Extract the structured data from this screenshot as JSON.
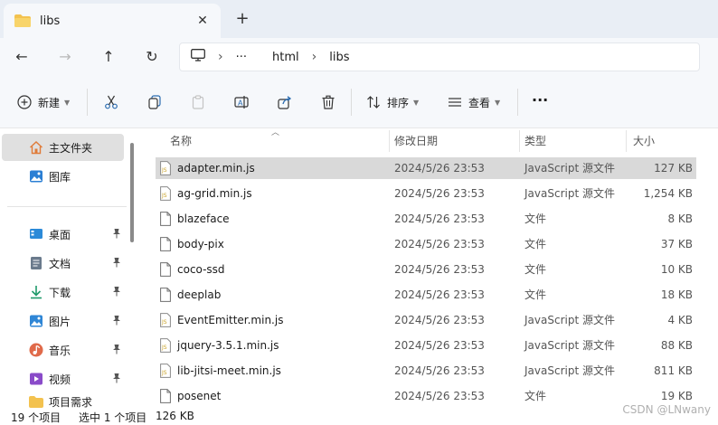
{
  "tab": {
    "title": "libs",
    "close_glyph": "✕",
    "new_glyph": "+"
  },
  "nav": {
    "back_glyph": "←",
    "forward_glyph": "→",
    "up_glyph": "↑",
    "refresh_glyph": "↻"
  },
  "address": {
    "more": "···",
    "crumbs": [
      "html",
      "libs"
    ]
  },
  "commands": {
    "new_label": "新建",
    "sort_label": "排序",
    "view_label": "查看",
    "more_glyph": "···"
  },
  "sidebar": {
    "items": [
      {
        "label": "主文件夹",
        "icon": "home-icon",
        "active": true
      },
      {
        "label": "图库",
        "icon": "gallery-icon"
      },
      {
        "label": "桌面",
        "icon": "desktop-icon",
        "pinned": true
      },
      {
        "label": "文档",
        "icon": "documents-icon",
        "pinned": true
      },
      {
        "label": "下载",
        "icon": "downloads-icon",
        "pinned": true
      },
      {
        "label": "图片",
        "icon": "pictures-icon",
        "pinned": true
      },
      {
        "label": "音乐",
        "icon": "music-icon",
        "pinned": true
      },
      {
        "label": "视频",
        "icon": "videos-icon",
        "pinned": true
      },
      {
        "label": "项目需求",
        "icon": "folder-icon"
      }
    ],
    "pin_glyph": "📌"
  },
  "columns": {
    "name": "名称",
    "date": "修改日期",
    "type": "类型",
    "size": "大小"
  },
  "files": [
    {
      "name": "adapter.min.js",
      "date": "2024/5/26 23:53",
      "type": "JavaScript 源文件",
      "size": "127 KB",
      "kind": "js",
      "selected": true
    },
    {
      "name": "ag-grid.min.js",
      "date": "2024/5/26 23:53",
      "type": "JavaScript 源文件",
      "size": "1,254 KB",
      "kind": "js"
    },
    {
      "name": "blazeface",
      "date": "2024/5/26 23:53",
      "type": "文件",
      "size": "8 KB",
      "kind": "file"
    },
    {
      "name": "body-pix",
      "date": "2024/5/26 23:53",
      "type": "文件",
      "size": "37 KB",
      "kind": "file"
    },
    {
      "name": "coco-ssd",
      "date": "2024/5/26 23:53",
      "type": "文件",
      "size": "10 KB",
      "kind": "file"
    },
    {
      "name": "deeplab",
      "date": "2024/5/26 23:53",
      "type": "文件",
      "size": "18 KB",
      "kind": "file"
    },
    {
      "name": "EventEmitter.min.js",
      "date": "2024/5/26 23:53",
      "type": "JavaScript 源文件",
      "size": "4 KB",
      "kind": "js"
    },
    {
      "name": "jquery-3.5.1.min.js",
      "date": "2024/5/26 23:53",
      "type": "JavaScript 源文件",
      "size": "88 KB",
      "kind": "js"
    },
    {
      "name": "lib-jitsi-meet.min.js",
      "date": "2024/5/26 23:53",
      "type": "JavaScript 源文件",
      "size": "811 KB",
      "kind": "js"
    },
    {
      "name": "posenet",
      "date": "2024/5/26 23:53",
      "type": "文件",
      "size": "19 KB",
      "kind": "file"
    }
  ],
  "status": {
    "count": "19 个项目",
    "selected": "选中 1 个项目",
    "selected_size": "126 KB"
  },
  "watermark": "CSDN @LNwany",
  "colors": {
    "accent": "#0067c0",
    "folder": "#f3c24f",
    "selection": "#d9d9d9",
    "js_icon": "#c9a227"
  }
}
